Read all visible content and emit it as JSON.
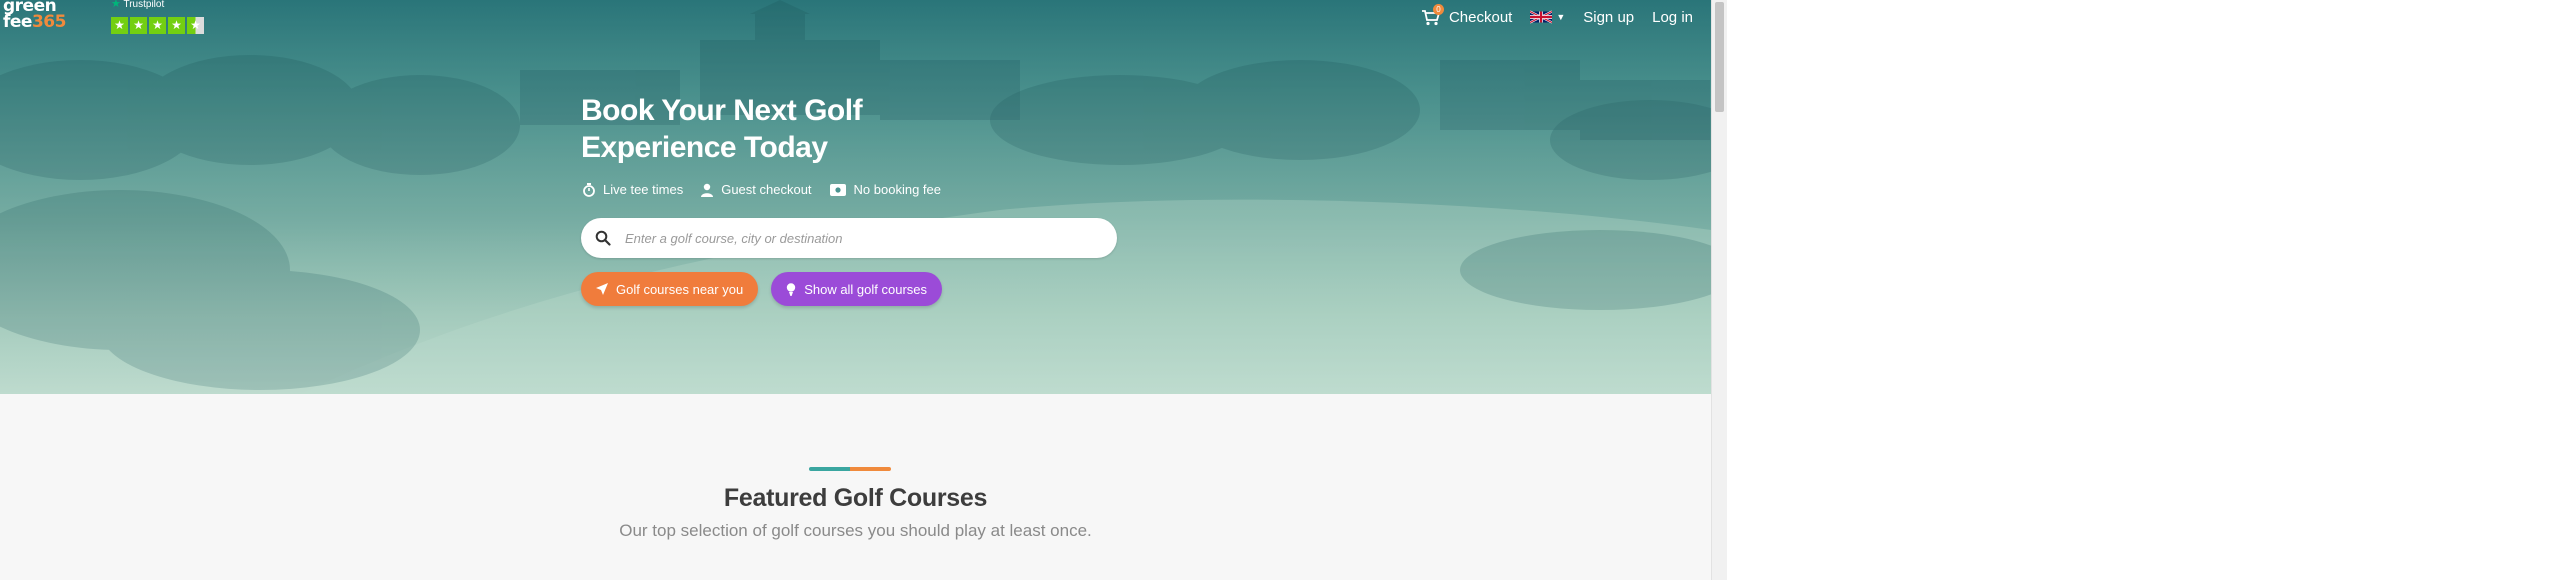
{
  "header": {
    "logo": {
      "line1": "green",
      "line2": "fee",
      "line2_num": "365"
    },
    "trustpilot": {
      "label": "Trustpilot",
      "rating_stars": 4.5
    },
    "nav": {
      "cart_badge": "0",
      "checkout": "Checkout",
      "language_flag": "uk-flag-icon",
      "signup": "Sign up",
      "login": "Log in"
    }
  },
  "hero": {
    "headline": "Book Your Next Golf Experience Today",
    "features": [
      {
        "icon": "stopwatch-icon",
        "label": "Live tee times"
      },
      {
        "icon": "user-icon",
        "label": "Guest checkout"
      },
      {
        "icon": "ticket-icon",
        "label": "No booking fee"
      }
    ],
    "search": {
      "icon": "search-icon",
      "placeholder": "Enter a golf course, city or destination",
      "value": ""
    },
    "buttons": {
      "near": {
        "icon": "location-arrow-icon",
        "label": "Golf courses near you"
      },
      "all": {
        "icon": "golf-ball-tee-icon",
        "label": "Show all golf courses"
      }
    }
  },
  "featured": {
    "title": "Featured Golf Courses",
    "subtitle": "Our top selection of golf courses you should play at least once."
  },
  "colors": {
    "accent_orange": "#f07c3c",
    "accent_purple": "#9b4bd8",
    "teal": "#2a7579",
    "trustpilot_green": "#73cf11"
  }
}
